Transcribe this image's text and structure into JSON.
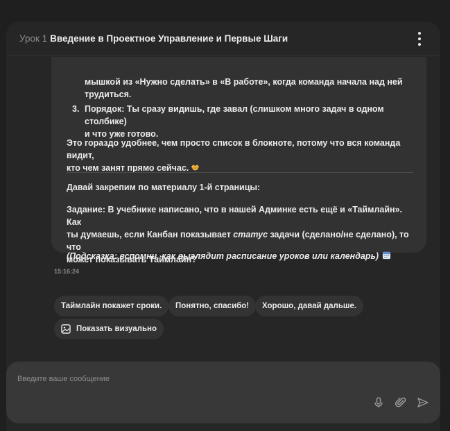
{
  "header": {
    "lesson": "Урок 1",
    "title": "Введение в Проектное Управление и Первые Шаги"
  },
  "message": {
    "list_tail": "мышкой из «Нужно сделать» в «В работе», когда команда начала над ней",
    "list_tail_2": "трудиться.",
    "item3_num": "3.",
    "item3_bold": "Порядок:",
    "item3_text": " Ты сразу видишь, где завал (слишком много задач в одном столбике)",
    "item3_text_2": "и что уже готово.",
    "para1_line1": "Это гораздо удобнее, чем просто список в блокноте, потому что вся команда видит,",
    "para1_line2": "кто чем занят прямо сейчас.",
    "para1_emoji": "handshake-emoji",
    "para2": "Давай закрепим по материалу 1-й страницы:",
    "task_line1": "Задание: В учебнике написано, что в нашей Админке есть ещё и «Таймлайн». Как",
    "task_line2_a": "ты думаешь, если Канбан показывает ",
    "task_line2_italic": "статус",
    "task_line2_b": " задачи (сделано/не сделано), то что",
    "task_line3": "может показывать Таймлайн?",
    "hint": "(Подсказка: вспомни, как выглядит расписание уроков или календарь)",
    "hint_emoji": "calendar-emoji"
  },
  "timestamp": "15:16:24",
  "quick_replies": [
    "Таймлайн покажет сроки.",
    "Понятно, спасибо!",
    "Хорошо, давай дальше."
  ],
  "visual_button": {
    "label": "Показать визуально",
    "icon": "image-icon"
  },
  "composer": {
    "placeholder": "Введите ваше сообщение",
    "value": "",
    "icons": [
      "microphone-icon",
      "paperclip-icon",
      "send-icon"
    ]
  },
  "colors": {
    "background": "#1f1f1f",
    "panel": "#262626",
    "bubble": "#323232",
    "chip": "#333333",
    "composer": "#383838"
  }
}
